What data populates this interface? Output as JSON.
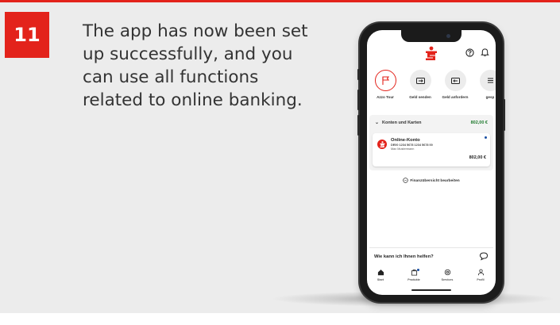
{
  "step": {
    "number": "11",
    "text": "The app has now been set up successfully, and you can use all functions related to online banking."
  },
  "colors": {
    "accent_red": "#e3231b",
    "balance_green": "#1f7a2e",
    "panel_bg": "#ececec"
  },
  "app": {
    "header_icons": [
      "sparkasse-logo-icon",
      "help-icon",
      "bell-icon"
    ],
    "actions": [
      {
        "label": "Azzo Tour",
        "icon": "tour-icon"
      },
      {
        "label": "Geld senden",
        "icon": "send-money-icon"
      },
      {
        "label": "Geld anfordern",
        "icon": "request-money-icon"
      },
      {
        "label": "gesp",
        "icon": "list-icon"
      }
    ],
    "accounts_section": {
      "title": "Konten und Karten",
      "total": "802,00 €"
    },
    "account": {
      "name": "Online-Konto",
      "iban": "DE00 1234 5678 1234 5678 00",
      "holder": "Max Mustermann",
      "amount": "802,00 €"
    },
    "edit_overview": "Finanzübersicht bearbeiten",
    "help_prompt": "Wie kann ich Ihnen helfen?",
    "tabs": [
      {
        "label": "Start",
        "icon": "home-icon"
      },
      {
        "label": "Produkte",
        "icon": "products-icon"
      },
      {
        "label": "Services",
        "icon": "services-icon"
      },
      {
        "label": "Profil",
        "icon": "profile-icon"
      }
    ]
  }
}
